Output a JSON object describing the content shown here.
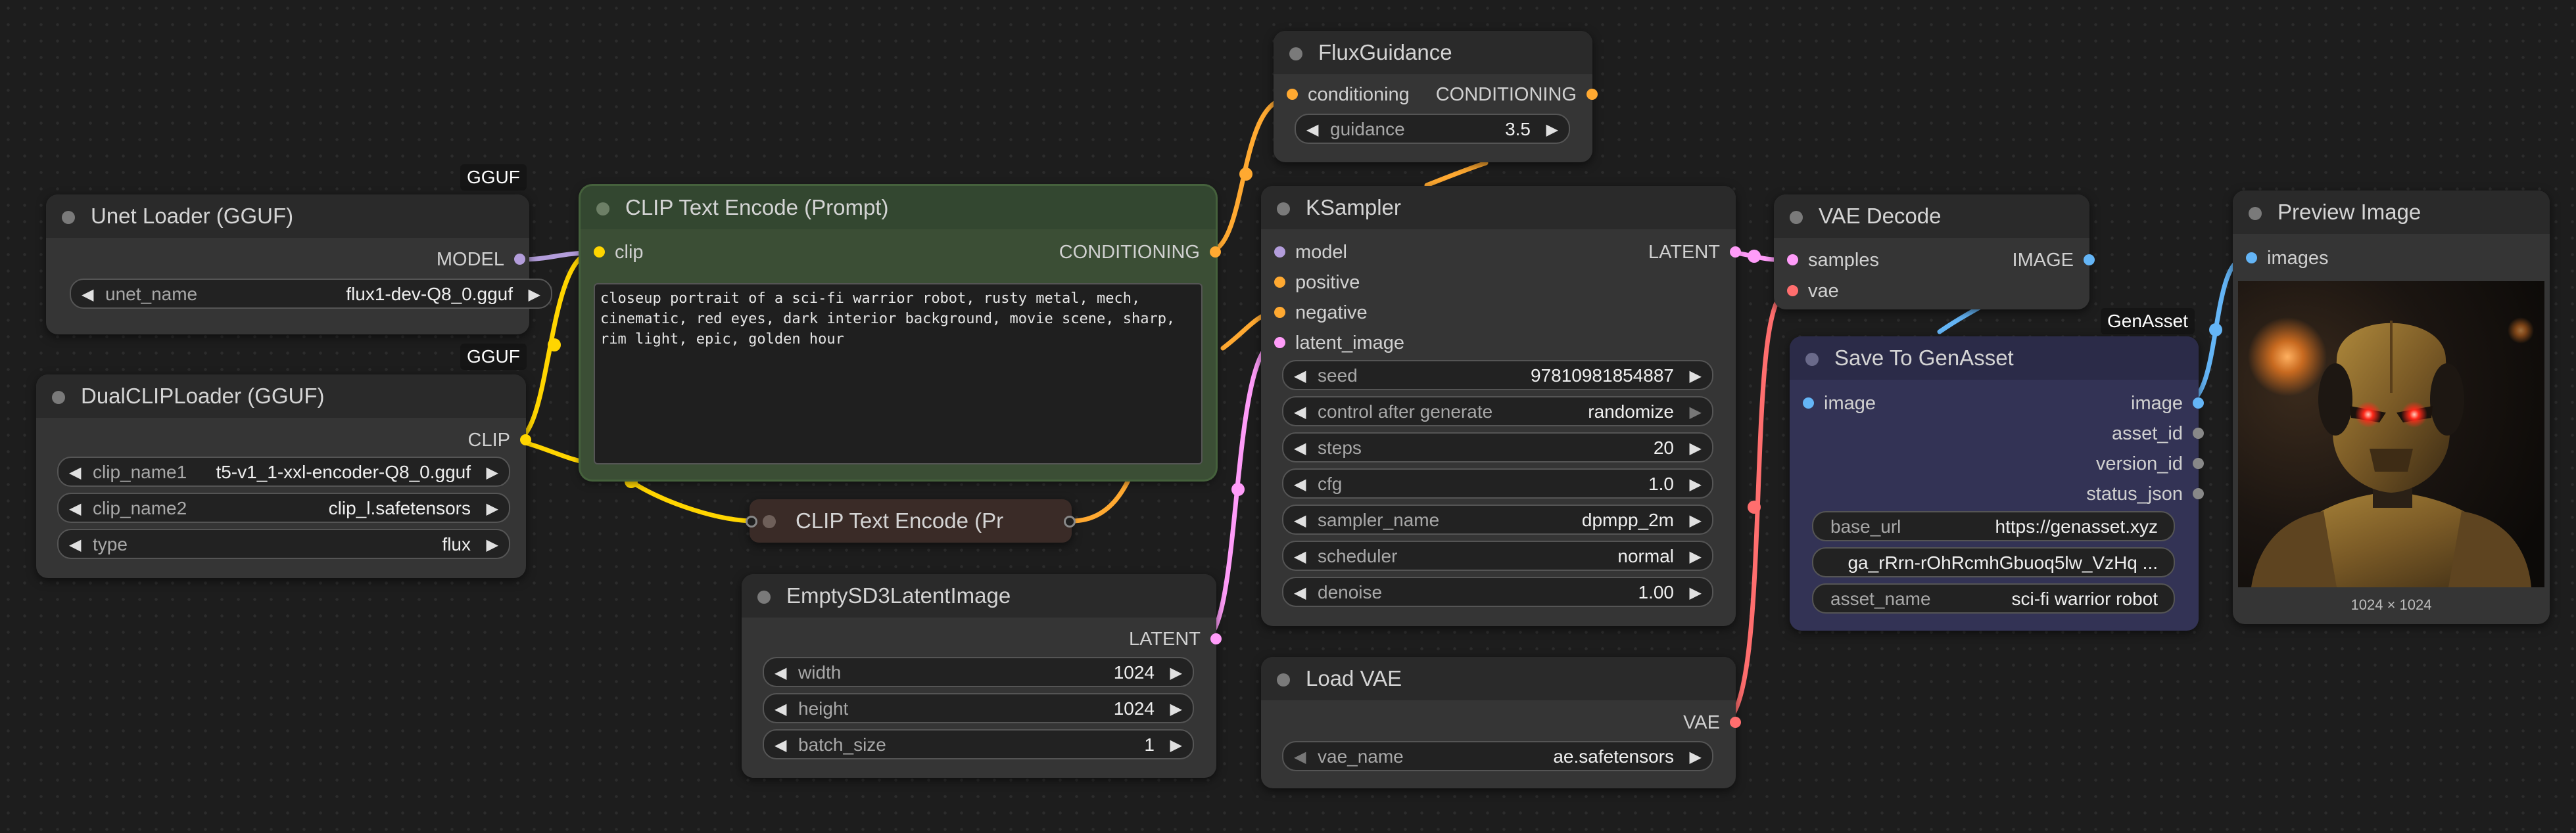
{
  "badges": {
    "gguf_a": "GGUF",
    "gguf_b": "GGUF",
    "genasset": "GenAsset"
  },
  "colors": {
    "canvas_bg": "#1d1d1d",
    "node_bg": "#353535",
    "clip_text_node_bg": "#3b4e35",
    "save_node_bg": "#333355",
    "slot_clip": "#ffd500",
    "slot_conditioning": "#ffa931",
    "slot_model": "#b39ddb",
    "slot_latent": "#ff9cf9",
    "slot_vae": "#ff6e6e",
    "slot_image": "#64b5f6"
  },
  "unet_loader": {
    "title": "Unet Loader (GGUF)",
    "output_model": "MODEL",
    "unet_name_label": "unet_name",
    "unet_name_value": "flux1-dev-Q8_0.gguf"
  },
  "dual_clip_loader": {
    "title": "DualCLIPLoader (GGUF)",
    "output_clip": "CLIP",
    "clip_name1_label": "clip_name1",
    "clip_name1_value": "t5-v1_1-xxl-encoder-Q8_0.gguf",
    "clip_name2_label": "clip_name2",
    "clip_name2_value": "clip_l.safetensors",
    "type_label": "type",
    "type_value": "flux"
  },
  "clip_text_encode": {
    "title": "CLIP Text Encode (Prompt)",
    "input_clip": "clip",
    "output_conditioning": "CONDITIONING",
    "prompt": "closeup portrait of a sci-fi warrior robot, rusty metal, mech,\ncinematic, red eyes, dark interior background, movie scene, sharp,\nrim light, epic, golden hour"
  },
  "clip_text_encode_collapsed": {
    "title": "CLIP Text Encode (Pr"
  },
  "empty_latent": {
    "title": "EmptySD3LatentImage",
    "output_latent": "LATENT",
    "width_label": "width",
    "width_value": "1024",
    "height_label": "height",
    "height_value": "1024",
    "batch_label": "batch_size",
    "batch_value": "1"
  },
  "flux_guidance": {
    "title": "FluxGuidance",
    "input_conditioning": "conditioning",
    "output_conditioning": "CONDITIONING",
    "guidance_label": "guidance",
    "guidance_value": "3.5"
  },
  "ksampler": {
    "title": "KSampler",
    "input_model": "model",
    "input_positive": "positive",
    "input_negative": "negative",
    "input_latent": "latent_image",
    "output_latent": "LATENT",
    "seed_label": "seed",
    "seed_value": "97810981854887",
    "control_label": "control after generate",
    "control_value": "randomize",
    "steps_label": "steps",
    "steps_value": "20",
    "cfg_label": "cfg",
    "cfg_value": "1.0",
    "sampler_label": "sampler_name",
    "sampler_value": "dpmpp_2m",
    "scheduler_label": "scheduler",
    "scheduler_value": "normal",
    "denoise_label": "denoise",
    "denoise_value": "1.00"
  },
  "load_vae": {
    "title": "Load VAE",
    "output_vae": "VAE",
    "vae_name_label": "vae_name",
    "vae_name_value": "ae.safetensors"
  },
  "vae_decode": {
    "title": "VAE Decode",
    "input_samples": "samples",
    "input_vae": "vae",
    "output_image": "IMAGE"
  },
  "save_to_genasset": {
    "title": "Save To GenAsset",
    "input_image": "image",
    "output_image": "image",
    "output_asset_id": "asset_id",
    "output_version_id": "version_id",
    "output_status_json": "status_json",
    "base_url_label": "base_url",
    "base_url_value": "https://genasset.xyz",
    "token_value": "ga_rRrn-rOhRcmhGbuoq5lw_VzHq  ...",
    "asset_name_label": "asset_name",
    "asset_name_value": "sci-fi warrior robot"
  },
  "preview_image": {
    "title": "Preview Image",
    "input_images": "images",
    "dimensions": "1024 × 1024"
  }
}
